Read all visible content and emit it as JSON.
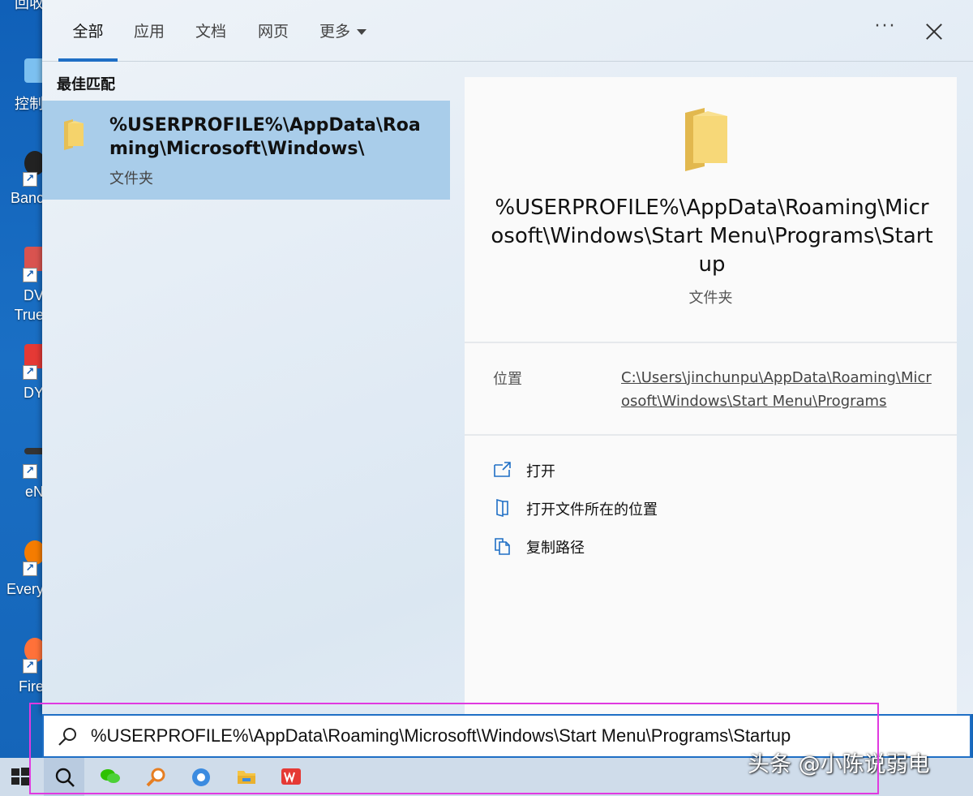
{
  "desktop": {
    "icons": [
      {
        "label": "回收",
        "name": "desktop-icon-recycle",
        "color": "#d9dde3"
      },
      {
        "label": "控制",
        "name": "desktop-icon-control-panel",
        "color": "#7cc0f0"
      },
      {
        "label": "Banc",
        "name": "desktop-icon-bandicam",
        "color": "#222222"
      },
      {
        "label": "DV",
        "name": "desktop-icon-dvd",
        "color": "#d9534f"
      },
      {
        "label": "True",
        "name": "desktop-icon-true",
        "color": ""
      },
      {
        "label": "DY",
        "name": "desktop-icon-dy",
        "color": "#e53935"
      },
      {
        "label": "eN",
        "name": "desktop-icon-en",
        "color": "#333333"
      },
      {
        "label": "Every",
        "name": "desktop-icon-everything",
        "color": "#f57c00"
      },
      {
        "label": "Fire",
        "name": "desktop-icon-firefox",
        "color": "#ff7139"
      }
    ]
  },
  "tabs": [
    {
      "label": "全部",
      "active": true
    },
    {
      "label": "应用",
      "active": false
    },
    {
      "label": "文档",
      "active": false
    },
    {
      "label": "网页",
      "active": false
    },
    {
      "label": "更多",
      "active": false,
      "dropdown": true
    }
  ],
  "header": {
    "more_label": "···"
  },
  "best_match": {
    "heading": "最佳匹配",
    "title": "%USERPROFILE%\\AppData\\Roaming\\Microsoft\\Windows\\",
    "type": "文件夹"
  },
  "detail": {
    "title": "%USERPROFILE%\\AppData\\Roaming\\Microsoft\\Windows\\Start Menu\\Programs\\Startup",
    "type": "文件夹",
    "location_label": "位置",
    "location_value": "C:\\Users\\jinchunpu\\AppData\\Roaming\\Microsoft\\Windows\\Start Menu\\Programs",
    "actions": [
      {
        "label": "打开",
        "icon": "open-icon"
      },
      {
        "label": "打开文件所在的位置",
        "icon": "file-location-icon"
      },
      {
        "label": "复制路径",
        "icon": "copy-path-icon"
      }
    ]
  },
  "search": {
    "value": "%USERPROFILE%\\AppData\\Roaming\\Microsoft\\Windows\\Start Menu\\Programs\\Startup",
    "icon": "search-icon"
  },
  "taskbar": {
    "items": [
      "start-icon",
      "search-icon",
      "wechat-icon",
      "everything-search-icon",
      "browser-icon",
      "file-explorer-icon",
      "wps-icon"
    ]
  },
  "watermark": "头条 @小陈说弱电",
  "colors": {
    "accent": "#1f6fc5",
    "selection": "#a9cdea",
    "highlight_box": "#e03ae0",
    "folder": "#f5d36b"
  }
}
